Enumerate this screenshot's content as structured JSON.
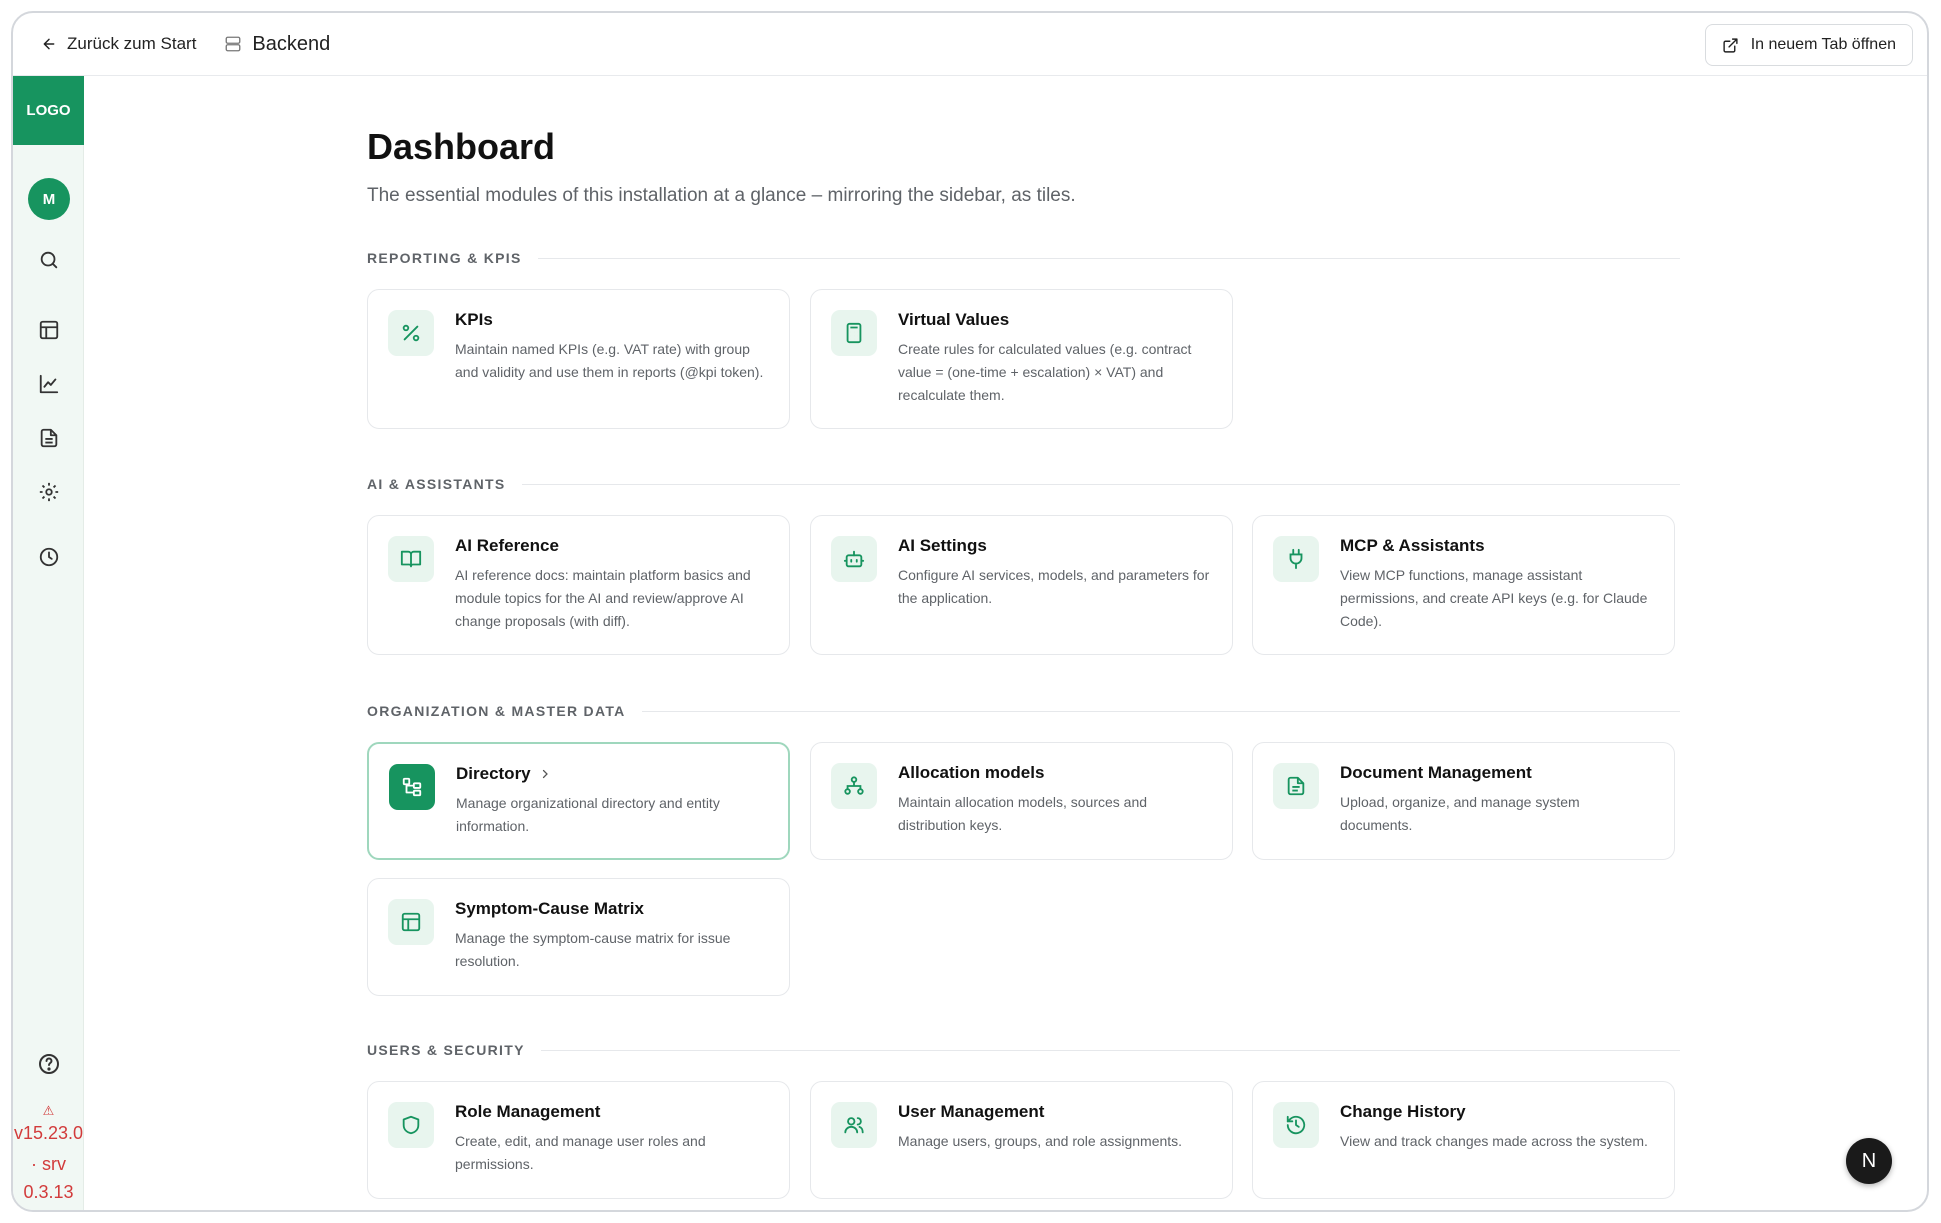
{
  "topbar": {
    "back_label": "Zurück zum Start",
    "crumb_label": "Backend",
    "open_tab_label": "In neuem Tab öffnen"
  },
  "sidebar": {
    "logo": "LOGO",
    "avatar": "M",
    "icons": [
      "search-icon",
      "table-icon",
      "chart-line-icon",
      "file-text-icon",
      "gear-icon",
      "clock-icon",
      "help-circle-icon"
    ],
    "warning_icon": "triangle-alert-icon",
    "version_lines": [
      "v15.23.0",
      "· srv",
      "0.3.13"
    ]
  },
  "page": {
    "title": "Dashboard",
    "subtitle": "The essential modules of this installation at a glance – mirroring the sidebar, as tiles."
  },
  "sections": [
    {
      "title": "REPORTING & KPIS",
      "cards": [
        {
          "title": "KPIs",
          "description": "Maintain named KPIs (e.g. VAT rate) with group and validity and use them in reports (@kpi token).",
          "icon": "percent-icon"
        },
        {
          "title": "Virtual Values",
          "description": "Create rules for calculated values (e.g. contract value = (one-time + escalation) × VAT) and recalculate them.",
          "icon": "calculator-icon"
        }
      ]
    },
    {
      "title": "AI & ASSISTANTS",
      "cards": [
        {
          "title": "AI Reference",
          "description": "AI reference docs: maintain platform basics and module topics for the AI and review/approve AI change proposals (with diff).",
          "icon": "book-open-icon"
        },
        {
          "title": "AI Settings",
          "description": "Configure AI services, models, and parameters for the application.",
          "icon": "bot-icon"
        },
        {
          "title": "MCP & Assistants",
          "description": "View MCP functions, manage assistant permissions, and create API keys (e.g. for Claude Code).",
          "icon": "plug-icon"
        }
      ]
    },
    {
      "title": "ORGANIZATION & MASTER DATA",
      "cards": [
        {
          "title": "Directory",
          "description": "Manage organizational directory and entity information.",
          "icon": "folder-tree-icon",
          "active": true
        },
        {
          "title": "Allocation models",
          "description": "Maintain allocation models, sources and distribution keys.",
          "icon": "network-icon"
        },
        {
          "title": "Document Management",
          "description": "Upload, organize, and manage system documents.",
          "icon": "document-icon"
        },
        {
          "title": "Symptom-Cause Matrix",
          "description": "Manage the symptom-cause matrix for issue resolution.",
          "icon": "grid-icon"
        }
      ]
    },
    {
      "title": "USERS & SECURITY",
      "cards": [
        {
          "title": "Role Management",
          "description": "Create, edit, and manage user roles and permissions.",
          "icon": "shield-icon"
        },
        {
          "title": "User Management",
          "description": "Manage users, groups, and role assignments.",
          "icon": "users-icon"
        },
        {
          "title": "Change History",
          "description": "View and track changes made across the system.",
          "icon": "history-icon"
        }
      ]
    }
  ],
  "fab": {
    "label": "N"
  },
  "colors": {
    "accent": "#17945f",
    "accent_light": "#e8f5ee",
    "version_red": "#d23b3b"
  }
}
